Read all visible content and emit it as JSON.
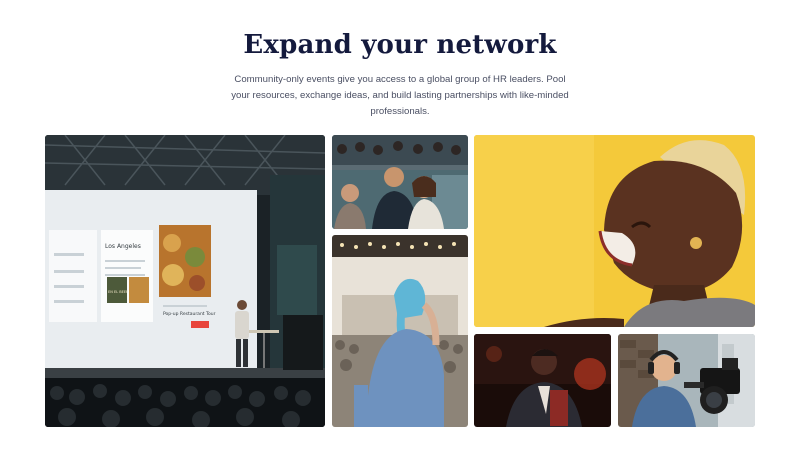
{
  "section": {
    "title": "Expand your network",
    "subtitle": "Community-only events give you access to a global group of HR leaders. Pool your resources, exchange ideas, and build lasting partnerships with like-minded professionals."
  },
  "stage_screen": {
    "heading": "Los Angeles",
    "card_title": "Pop-up Restaurant Tour",
    "poster_text": "EN EL BEEF"
  },
  "colors": {
    "title": "#141a3d",
    "subtitle": "#4a4f63",
    "yellow_bg": "#f4c93a",
    "screen_button": "#e8453c"
  }
}
